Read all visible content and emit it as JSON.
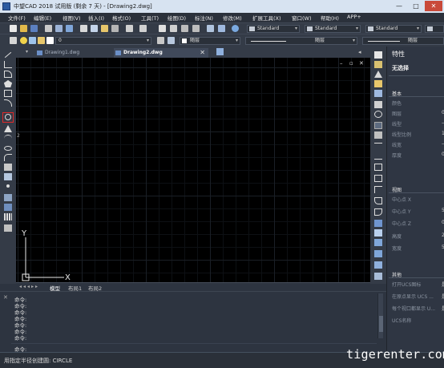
{
  "window": {
    "title": "中望CAD 2018 试用版 (剩余 7 天) - [Drawing2.dwg]",
    "controls": [
      "—",
      "□",
      "✕"
    ]
  },
  "menu": [
    "文件(F)",
    "编辑(E)",
    "视图(V)",
    "插入(I)",
    "格式(O)",
    "工具(T)",
    "绘图(D)",
    "标注(N)",
    "修改(M)",
    "扩展工具(X)",
    "窗口(W)",
    "帮助(H)",
    "APP+"
  ],
  "toolbar": {
    "text_style": "Standard",
    "dim_style": "Standard",
    "table_style": "Standard",
    "layer_value": "0",
    "color_value": "随层",
    "linetype_value": "随层",
    "lineweight_value": "随层"
  },
  "tabs": [
    {
      "label": "Drawing1.dwg",
      "active": false
    },
    {
      "label": "Drawing2.dwg",
      "active": true
    }
  ],
  "canvas": {
    "axis_y": "Y",
    "axis_x": "X",
    "left_marker": "2"
  },
  "layout_tabs": [
    "模型",
    "布局1",
    "布局2"
  ],
  "properties": {
    "header": "特性",
    "selection": "无选择",
    "sections": {
      "basic": "基本",
      "view": "视图",
      "other": "其他"
    },
    "basic_rows": [
      {
        "label": "颜色",
        "value": ""
      },
      {
        "label": "图层",
        "value": "0"
      },
      {
        "label": "线型",
        "value": "—"
      },
      {
        "label": "线型比例",
        "value": "1"
      },
      {
        "label": "线宽",
        "value": "—"
      },
      {
        "label": "厚度",
        "value": "0"
      }
    ],
    "view_rows": [
      {
        "label": "中心点 X",
        "value": ""
      },
      {
        "label": "中心点 Y",
        "value": "5"
      },
      {
        "label": "中心点 Z",
        "value": "0"
      },
      {
        "label": "高度",
        "value": "2"
      },
      {
        "label": "宽度",
        "value": "5"
      }
    ],
    "other_rows": [
      {
        "label": "打开UCS图标",
        "value": "是"
      },
      {
        "label": "在原点显示 UCS ...",
        "value": "是"
      },
      {
        "label": "每个视口都显示 U...",
        "value": "是"
      },
      {
        "label": "UCS名称",
        "value": ""
      }
    ]
  },
  "command_lines": [
    "命令:",
    "命令:",
    "命令:",
    "命令:",
    "命令:",
    "命令:",
    "命令:",
    "命令:"
  ],
  "status_text": "用指定半径创建圆: CIRCLE",
  "watermark": "tigerenter.com"
}
